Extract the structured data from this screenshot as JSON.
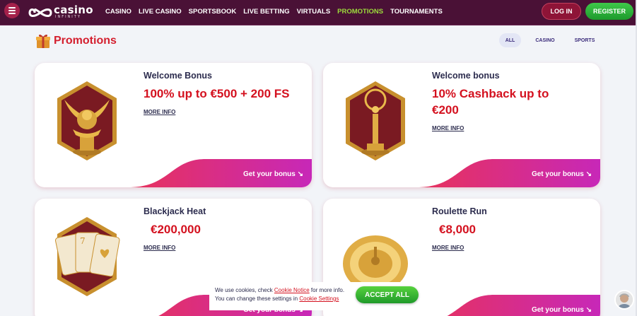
{
  "header": {
    "logo_main": "casino",
    "logo_sub": "INFINITY",
    "nav": [
      "CASINO",
      "LIVE CASINO",
      "SPORTSBOOK",
      "LIVE BETTING",
      "VIRTUALS",
      "PROMOTIONS",
      "TOURNAMENTS"
    ],
    "active_nav": "PROMOTIONS",
    "login": "LOG IN",
    "register": "REGISTER"
  },
  "page": {
    "title": "Promotions",
    "filters": [
      "ALL",
      "CASINO",
      "SPORTS"
    ],
    "active_filter": "ALL"
  },
  "promos": [
    {
      "title": "Welcome Bonus",
      "offer": "100% up to €500 + 200 FS",
      "more": "MORE INFO",
      "cta": "Get your bonus ↘",
      "icon": "winged-lion-trophy-icon"
    },
    {
      "title": "Welcome bonus",
      "offer": "10% Cashback up to €200",
      "more": "MORE INFO",
      "cta": "Get your bonus ↘",
      "icon": "statuette-trophy-icon"
    },
    {
      "title": "Blackjack Heat",
      "offer": "€200,000",
      "more": "MORE INFO",
      "cta": "Get your bonus ↘",
      "icon": "playing-cards-icon"
    },
    {
      "title": "Roulette Run",
      "offer": "€8,000",
      "more": "MORE INFO",
      "cta": "Get your bonus ↘",
      "icon": "roulette-wheel-icon"
    }
  ],
  "cookie": {
    "line1_pre": "We use cookies, check ",
    "line1_link": "Cookie Notice",
    "line1_post": " for more info.",
    "line2_pre": "You can change these settings in ",
    "line2_link": "Cookie Settings",
    "accept": "ACCEPT ALL"
  },
  "colors": {
    "header_bg": "#4a1136",
    "accent_red": "#d4111f",
    "active_nav": "#9ddc3c",
    "cta_gradient_start": "#e8325a",
    "cta_gradient_end": "#c728b8",
    "register_green": "#2fb53a"
  }
}
